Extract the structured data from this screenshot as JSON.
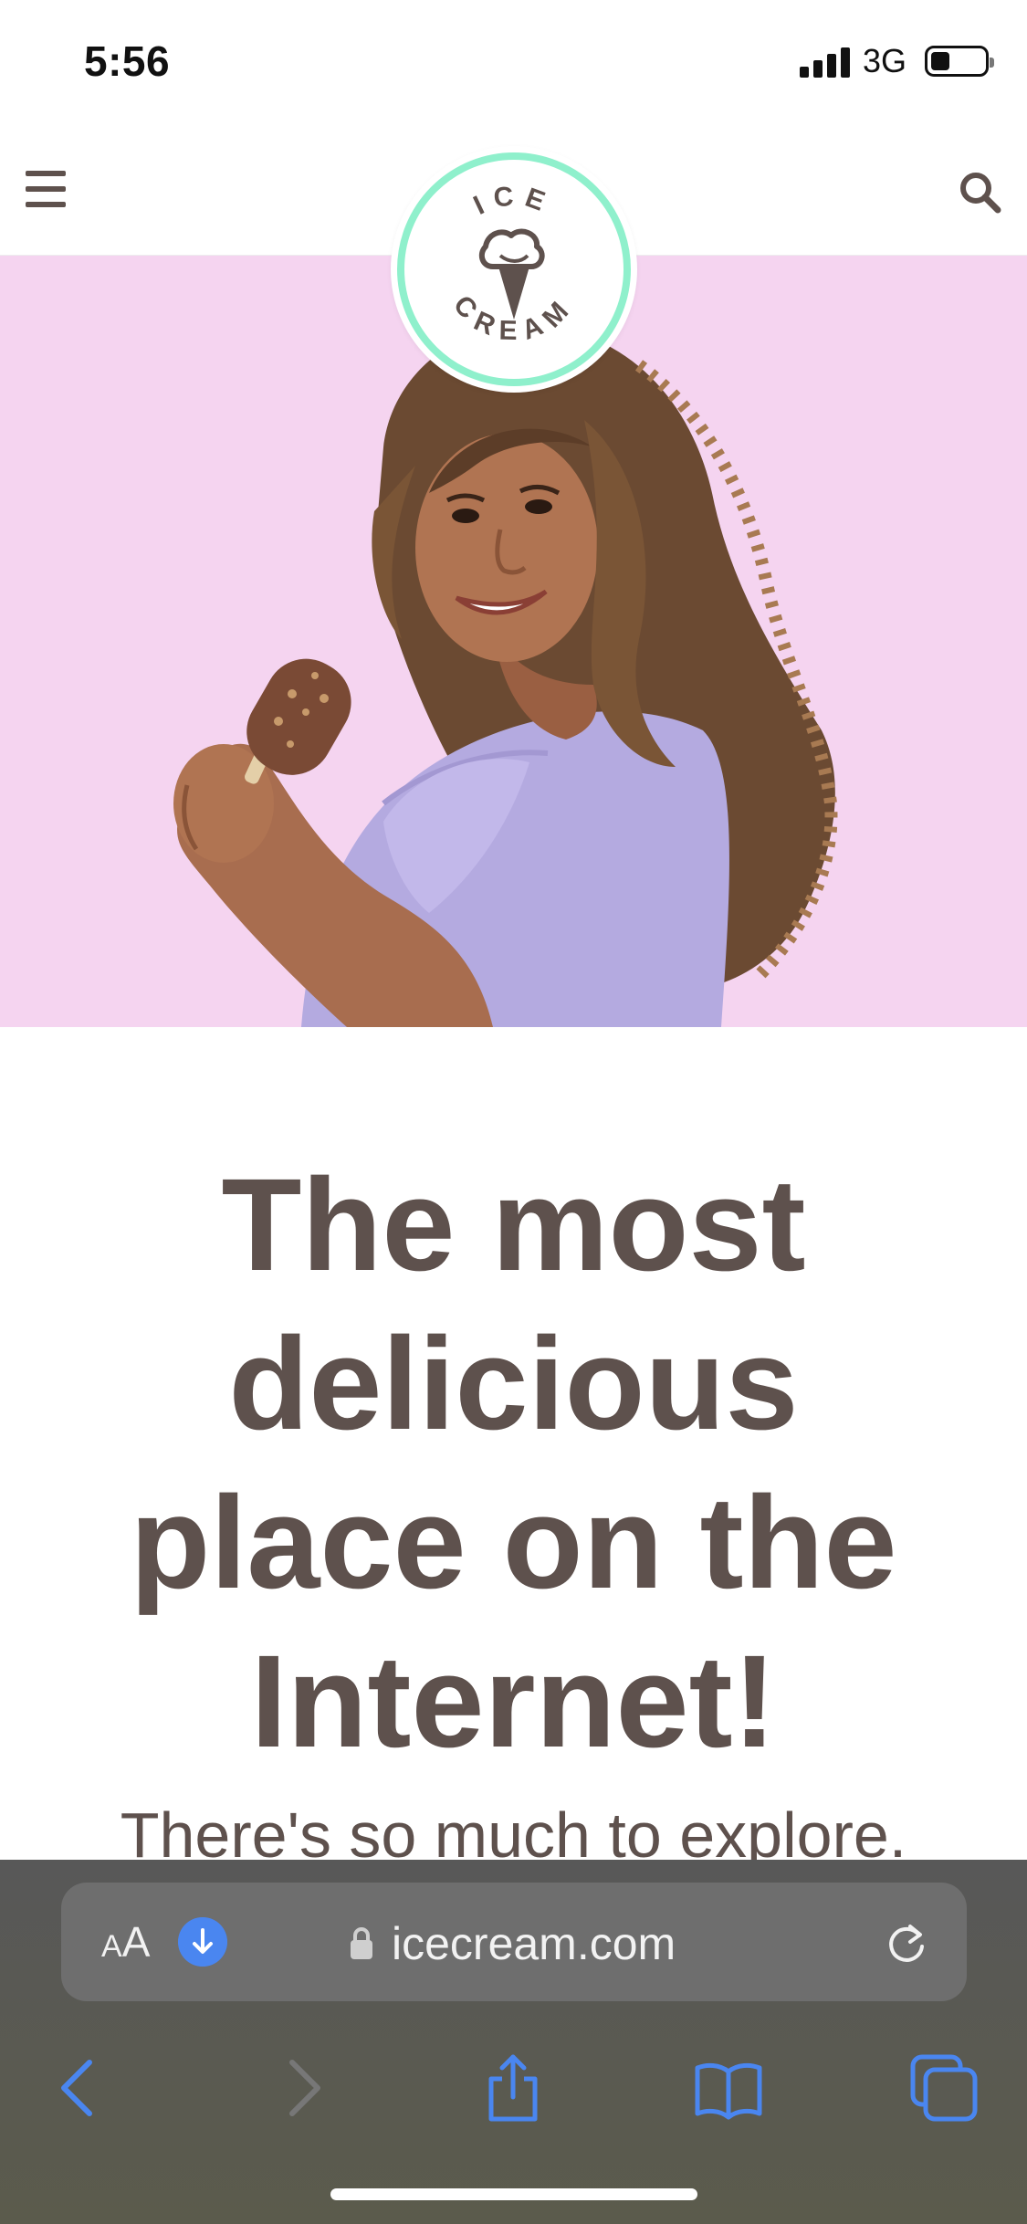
{
  "status_bar": {
    "time": "5:56",
    "network": "3G",
    "battery_level": 0.35
  },
  "header": {
    "logo_top_text": "ICE",
    "logo_bottom_text": "CREAM"
  },
  "main": {
    "headline_lines": [
      "The most",
      "delicious",
      "place on the",
      "Internet!"
    ],
    "subtext": "There's so much to explore."
  },
  "browser": {
    "text_size_small": "A",
    "text_size_big": "A",
    "url": "icecream.com"
  },
  "colors": {
    "hero_background": "#f5d4f0",
    "logo_ring": "#8ff0cc",
    "text_brown": "#5e514d",
    "ios_blue": "#4a86f0"
  },
  "icons": {
    "menu": "hamburger-menu-icon",
    "search": "search-icon",
    "back": "chevron-left-icon",
    "forward": "chevron-right-icon",
    "share": "share-icon",
    "bookmarks": "book-icon",
    "tabs": "tabs-icon",
    "reload": "reload-icon",
    "download": "download-icon",
    "lock": "lock-icon"
  }
}
